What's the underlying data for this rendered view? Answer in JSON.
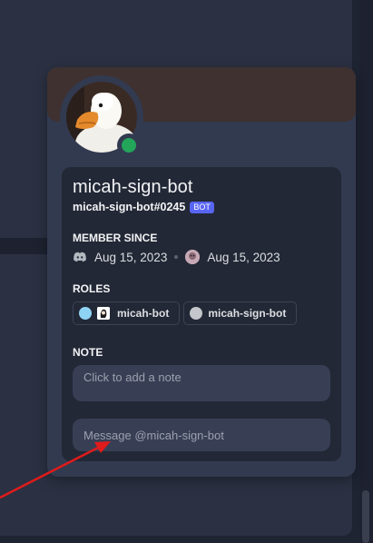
{
  "profile": {
    "display_name": "micah-sign-bot",
    "tag": "micah-sign-bot#0245",
    "badge": "BOT",
    "status": "online"
  },
  "member_since": {
    "title": "MEMBER SINCE",
    "discord_date": "Aug 15, 2023",
    "server_date": "Aug 15, 2023"
  },
  "roles": {
    "title": "ROLES",
    "items": [
      {
        "label": "micah-bot",
        "color": "#8fd3f4"
      },
      {
        "label": "micah-sign-bot",
        "color": "#c4c6cb"
      }
    ]
  },
  "note": {
    "title": "NOTE",
    "placeholder": "Click to add a note"
  },
  "message": {
    "placeholder": "Message @micah-sign-bot"
  },
  "colors": {
    "banner": "#3e3130",
    "status_online": "#23a55a",
    "bot_badge": "#5865f2",
    "annotation_arrow": "#e01b1b"
  }
}
